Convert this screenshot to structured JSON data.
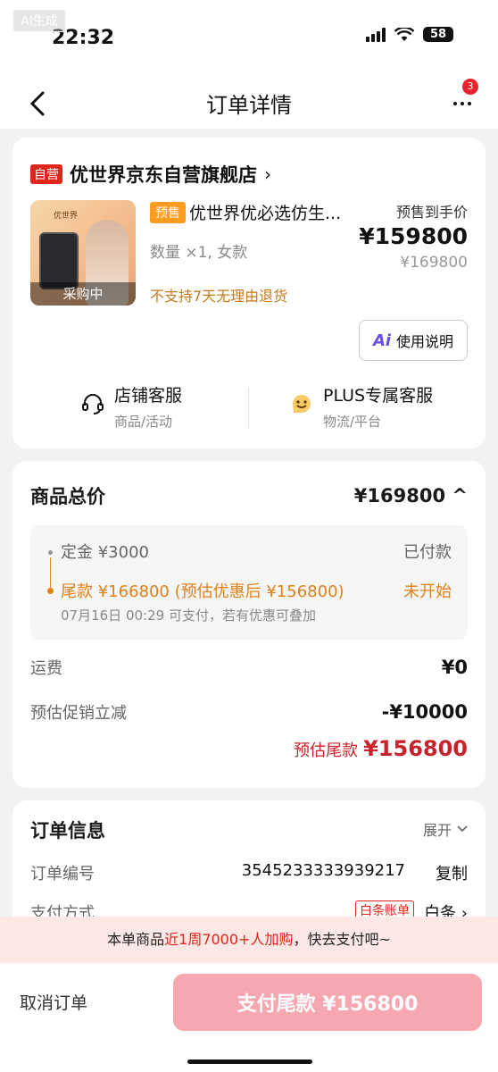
{
  "watermark": "AI生成",
  "status": {
    "time": "22:32",
    "battery": "58"
  },
  "nav": {
    "title": "订单详情",
    "badge": "3"
  },
  "shop": {
    "tag": "自营",
    "name": "优世界京东自营旗舰店",
    "chevron": "›"
  },
  "product": {
    "thumb_status": "采购中",
    "thumb_logo": "优世界",
    "presale_tag": "预售",
    "name": "优世界优必选仿生...",
    "spec": "数量 ×1, 女款",
    "warning": "不支持7天无理由退货",
    "price_label": "预售到手价",
    "price": "¥159800",
    "orig_price": "¥169800"
  },
  "guide_button": {
    "icon": "Ai",
    "label": "使用说明"
  },
  "services": [
    {
      "title": "店铺客服",
      "sub": "商品/活动"
    },
    {
      "title": "PLUS专属客服",
      "sub": "物流/平台"
    }
  ],
  "totals": {
    "label": "商品总价",
    "value": "¥169800 ^",
    "deposit": "定金 ¥3000",
    "deposit_status": "已付款",
    "balance": "尾款 ¥166800 (预估优惠后 ¥156800)",
    "balance_status": "未开始",
    "balance_note": "07月16日 00:29 可支付，若有优惠可叠加",
    "shipping_label": "运费",
    "shipping_value": "¥0",
    "promo_label": "预估促销立减",
    "promo_value": "-¥10000",
    "est_label": "预估尾款",
    "est_value": "¥156800"
  },
  "order_info": {
    "title": "订单信息",
    "expand_label": "展开",
    "order_no_label": "订单编号",
    "order_no": "3545233333939217",
    "copy_label": "复制",
    "pay_method_label": "支付方式",
    "pay_method_tag": "白条账单",
    "pay_method_value": "白条 ›"
  },
  "promo_bar": {
    "prefix": "本单商品",
    "highlight": "近1周7000+人加购",
    "suffix": "，快去支付吧~"
  },
  "bottom": {
    "cancel_label": "取消订单",
    "pay_label": "支付尾款 ¥156800"
  },
  "colors": {
    "brand_red": "#e1251b",
    "presale_orange": "#ff9b1f",
    "pay_button": "#f7a7b0"
  }
}
